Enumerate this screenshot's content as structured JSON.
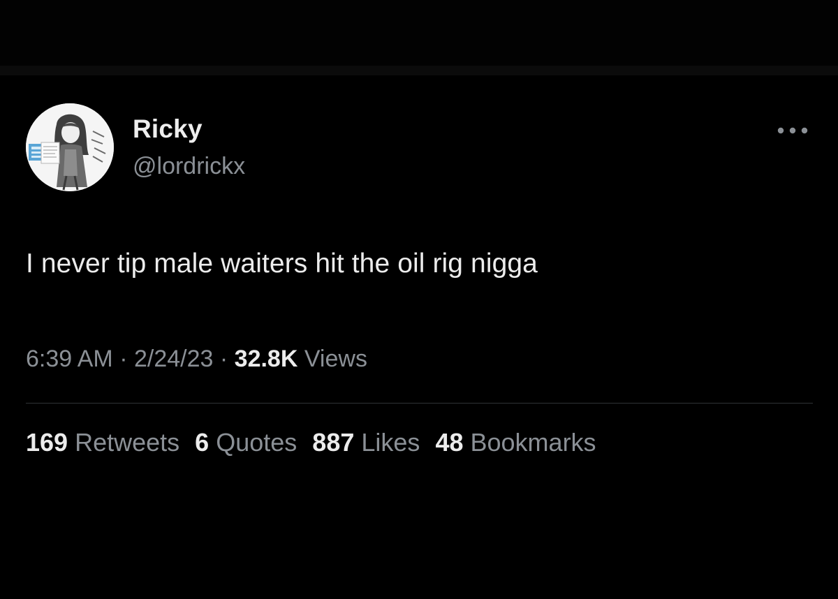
{
  "tweet": {
    "author": {
      "display_name": "Ricky",
      "handle": "@lordrickx"
    },
    "more_icon": "more-horizontal-icon",
    "text": "I never tip male waiters hit the oil rig nigga",
    "meta": {
      "time": "6:39 AM",
      "separator": "·",
      "date": "2/24/23",
      "views_count": "32.8K",
      "views_label": "Views"
    },
    "stats": {
      "retweets_count": "169",
      "retweets_label": "Retweets",
      "quotes_count": "6",
      "quotes_label": "Quotes",
      "likes_count": "887",
      "likes_label": "Likes",
      "bookmarks_count": "48",
      "bookmarks_label": "Bookmarks"
    }
  },
  "colors": {
    "background": "#000000",
    "primary_text": "#ececec",
    "secondary_text": "#8b9096",
    "divider": "#2f3336"
  }
}
